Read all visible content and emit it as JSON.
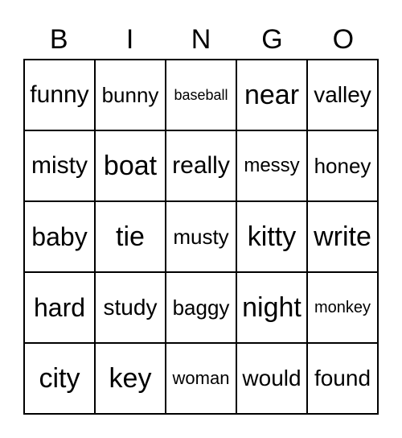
{
  "header": [
    "B",
    "I",
    "N",
    "G",
    "O"
  ],
  "cells": [
    [
      "funny",
      "bunny",
      "baseball",
      "near",
      "valley"
    ],
    [
      "misty",
      "boat",
      "really",
      "messy",
      "honey"
    ],
    [
      "baby",
      "tie",
      "musty",
      "kitty",
      "write"
    ],
    [
      "hard",
      "study",
      "baggy",
      "night",
      "monkey"
    ],
    [
      "city",
      "key",
      "woman",
      "would",
      "found"
    ]
  ]
}
